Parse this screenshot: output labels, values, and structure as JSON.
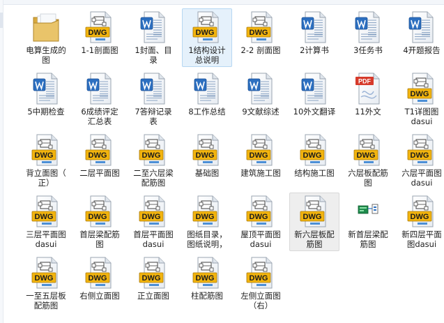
{
  "window": {
    "view": "large-icons"
  },
  "colors": {
    "selection": "#e5f1fb",
    "dwg_badge": "#f2b40e",
    "word_blue": "#2c6fc0",
    "pdf_red": "#d63a2b",
    "folder": "#e9c46a"
  },
  "files": [
    {
      "name": "电算生成的\n图",
      "type": "folder"
    },
    {
      "name": "1-1剖面图",
      "type": "dwg"
    },
    {
      "name": "1封面、目\n录",
      "type": "doc"
    },
    {
      "name": "1结构设计\n总说明",
      "type": "dwg",
      "state": "selected"
    },
    {
      "name": "2-2 剖面图",
      "type": "dwg"
    },
    {
      "name": "2计算书",
      "type": "doc"
    },
    {
      "name": "3任务书",
      "type": "doc"
    },
    {
      "name": "4开题报告",
      "type": "doc"
    },
    {
      "name": "5中期检查",
      "type": "doc"
    },
    {
      "name": "6成绩评定\n汇总表",
      "type": "doc"
    },
    {
      "name": "7答辩记录\n表",
      "type": "doc"
    },
    {
      "name": "8工作总结",
      "type": "doc"
    },
    {
      "name": "9文献综述",
      "type": "doc"
    },
    {
      "name": "10外文翻译",
      "type": "doc"
    },
    {
      "name": "11外文",
      "type": "pdf",
      "badge": "PDF"
    },
    {
      "name": "T1详图图\ndasui",
      "type": "dwg"
    },
    {
      "name": "背立面图（\n正）",
      "type": "dwg"
    },
    {
      "name": "二层平面图",
      "type": "dwg"
    },
    {
      "name": "二至六层梁\n配筋图",
      "type": "dwg"
    },
    {
      "name": "基础图",
      "type": "dwg"
    },
    {
      "name": "建筑施工图",
      "type": "dwg"
    },
    {
      "name": "结构施工图",
      "type": "dwg"
    },
    {
      "name": "六层板配筋\n图",
      "type": "dwg"
    },
    {
      "name": "六层平面图\ndasui",
      "type": "dwg"
    },
    {
      "name": "三层平面图\ndasui",
      "type": "dwg"
    },
    {
      "name": "首层梁配筋\n图",
      "type": "dwg"
    },
    {
      "name": "首层平面图\ndasui",
      "type": "dwg"
    },
    {
      "name": "图纸目录，\n图纸说明，",
      "type": "dwg"
    },
    {
      "name": "屋顶平面图\ndasui",
      "type": "dwg"
    },
    {
      "name": "新六层板配\n筋图",
      "type": "dwg",
      "state": "hover"
    },
    {
      "name": "新首层梁配\n筋图",
      "type": "app"
    },
    {
      "name": "新四层平面\n图dasui",
      "type": "dwg"
    },
    {
      "name": "一至五层板\n配筋图",
      "type": "dwg"
    },
    {
      "name": "右侧立面图",
      "type": "dwg"
    },
    {
      "name": "正立面图",
      "type": "dwg"
    },
    {
      "name": "柱配筋图",
      "type": "dwg"
    },
    {
      "name": "左侧立面图\n（右）",
      "type": "dwg"
    }
  ],
  "icon_text": {
    "dwg": "DWG",
    "pdf": "PDF"
  }
}
